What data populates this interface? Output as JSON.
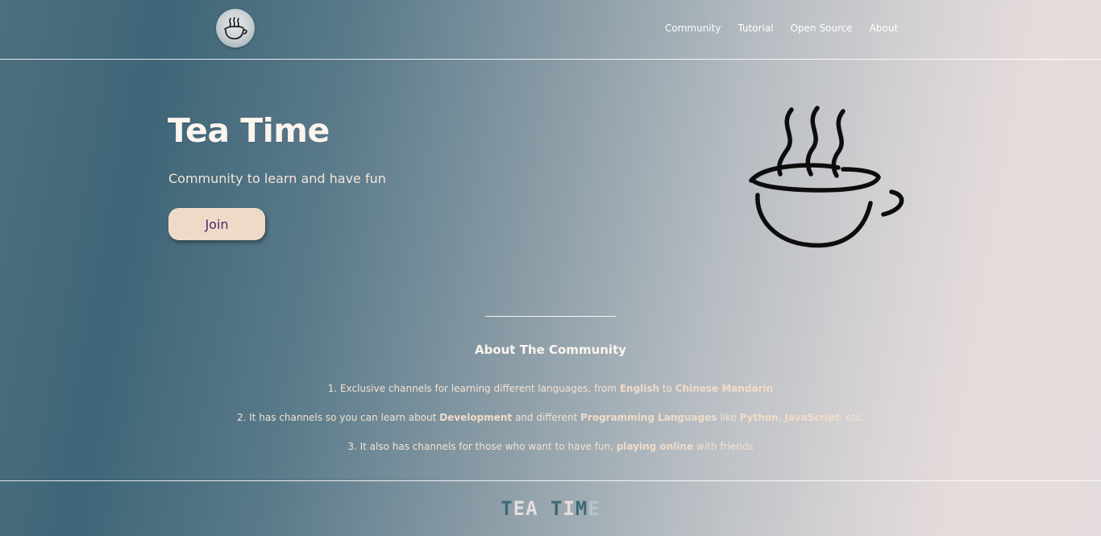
{
  "header": {
    "nav": [
      {
        "label": "Community"
      },
      {
        "label": "Tutorial"
      },
      {
        "label": "Open Source"
      },
      {
        "label": "About"
      }
    ],
    "logo_icon": "teacup-icon"
  },
  "hero": {
    "title": "Tea Time",
    "subtitle": "Community to learn and have fun",
    "join_label": "Join",
    "illustration_icon": "steaming-teacup-icon"
  },
  "about": {
    "title": "About The Community",
    "items": [
      {
        "t1": "1. Exclusive channels for learning different languages, from ",
        "b1": "English",
        "t2": " to ",
        "b2": "Chinese Mandarin"
      },
      {
        "t1": "2. It has channels so you can learn about ",
        "b1": "Development",
        "t2": " and different ",
        "b2": "Programming Languages",
        "t3": " like ",
        "b3": "Python",
        "t4": ", ",
        "b4": "JavaScript",
        "t5": ", etc."
      },
      {
        "t1": "3. It also has channels for those who want to have fun, ",
        "b1": "playing online",
        "t2": " with friends"
      }
    ]
  },
  "footer": {
    "brand_letters": [
      "T",
      "E",
      "A",
      " ",
      "T",
      "I",
      "M",
      "E"
    ]
  },
  "colors": {
    "accent_button": "#eddbc8",
    "button_text": "#4a2a66",
    "footer_dark": "#3e6878"
  }
}
